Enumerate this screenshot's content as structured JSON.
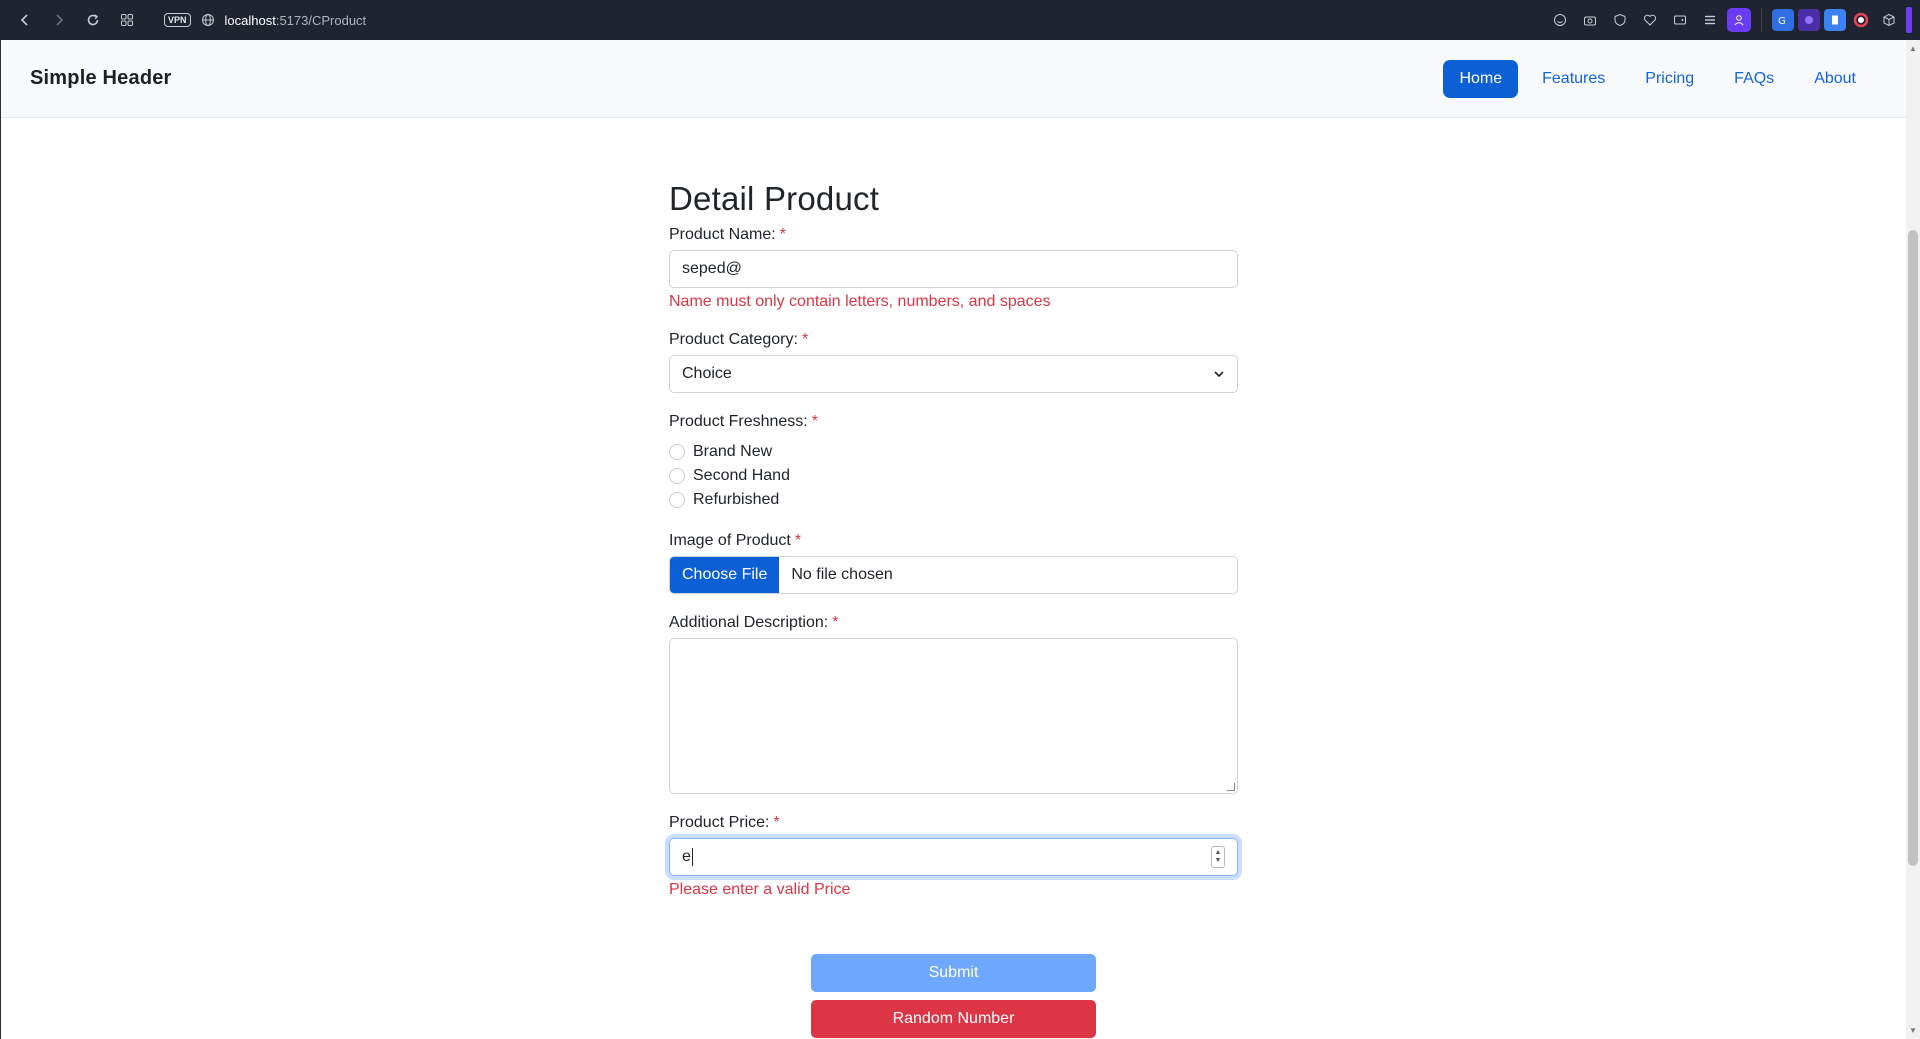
{
  "browser": {
    "vpn_label": "VPN",
    "url_host": "localhost",
    "url_path": ":5173/CProduct"
  },
  "header": {
    "brand": "Simple Header",
    "nav": [
      {
        "label": "Home",
        "active": true
      },
      {
        "label": "Features"
      },
      {
        "label": "Pricing"
      },
      {
        "label": "FAQs"
      },
      {
        "label": "About"
      }
    ]
  },
  "form": {
    "title": "Detail Product",
    "required_mark": "*",
    "name": {
      "label": "Product Name:",
      "value": "seped@",
      "error": "Name must only contain letters, numbers, and spaces"
    },
    "category": {
      "label": "Product Category:",
      "selected": "Choice"
    },
    "freshness": {
      "label": "Product Freshness:",
      "options": [
        "Brand New",
        "Second Hand",
        "Refurbished"
      ]
    },
    "image": {
      "label": "Image of Product",
      "button": "Choose File",
      "status": "No file chosen"
    },
    "description": {
      "label": "Additional Description:",
      "value": ""
    },
    "price": {
      "label": "Product Price:",
      "value": "e",
      "error": "Please enter a valid Price"
    }
  },
  "actions": {
    "submit": "Submit",
    "random": "Random Number"
  },
  "colors": {
    "primary": "#0d5fd6",
    "submit_disabled": "#6ea8fe",
    "danger": "#dc3545"
  }
}
